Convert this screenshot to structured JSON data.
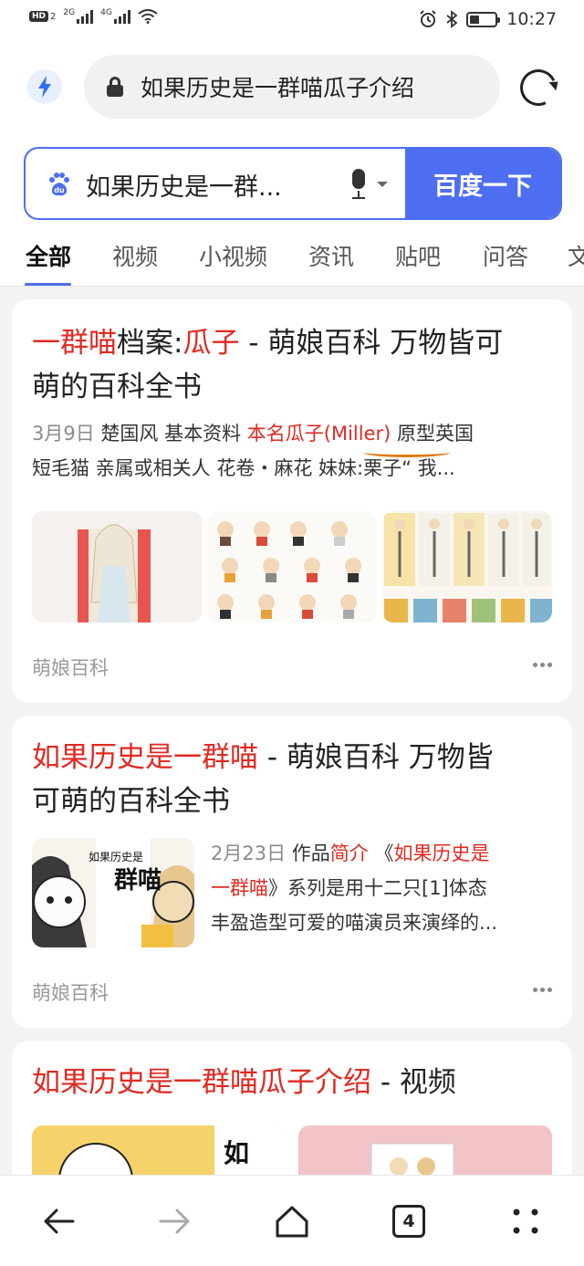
{
  "status_bar": {
    "left_badge": "HD",
    "sim_num": "2",
    "net_1": "2G",
    "net_2": "4G",
    "time": "10:27",
    "battery_level": 0.4
  },
  "browser": {
    "url_text": "如果历史是一群喵瓜子介绍",
    "bolt_icon": "lightning-icon",
    "reload_icon": "reload-icon"
  },
  "search": {
    "query": "如果历史是一群...",
    "button_label": "百度一下"
  },
  "tabs": [
    {
      "label": "全部",
      "active": true
    },
    {
      "label": "视频"
    },
    {
      "label": "小视频"
    },
    {
      "label": "资讯"
    },
    {
      "label": "贴吧"
    },
    {
      "label": "问答"
    },
    {
      "label": "文"
    }
  ],
  "results": [
    {
      "title_red_1": "一群喵",
      "title_black_1": "档案:",
      "title_red_2": "瓜子",
      "title_black_2": " - 萌娘百科 万物皆可",
      "title_line2": "萌的百科全书",
      "date": "3月9日",
      "snippet_1": " 楚国风 基本资料 ",
      "snippet_red": "本名瓜子(Miller)",
      "snippet_2": " 原型英国",
      "snippet_line2": "短毛猫 亲属或相关人 花卷・麻花 妹妹:栗子“ 我...",
      "source": "萌娘百科"
    },
    {
      "title_red": "如果历史是一群喵",
      "title_black": " - 萌娘百科 万物皆",
      "title_line2": "可萌的百科全书",
      "date": "2月23日",
      "snippet_a": " 作品",
      "snippet_red_a": "简介",
      "snippet_b": " 《",
      "snippet_red_b": "如果历史是",
      "snippet_line2_red": "一群喵",
      "snippet_line2": "》系列是用十二只[1]体态",
      "snippet_line3": "丰盈造型可爱的喵演员来演绎的...",
      "thumb_text_1": "如果历史是",
      "thumb_text_2": "群喵",
      "source": "萌娘百科"
    },
    {
      "title_red": "如果历史是一群喵瓜子介绍",
      "title_black": " - 视频"
    }
  ],
  "bottom_nav": {
    "tab_count": "4"
  },
  "colors": {
    "accent": "#4e6ef2",
    "highlight_red": "#e02a22"
  }
}
